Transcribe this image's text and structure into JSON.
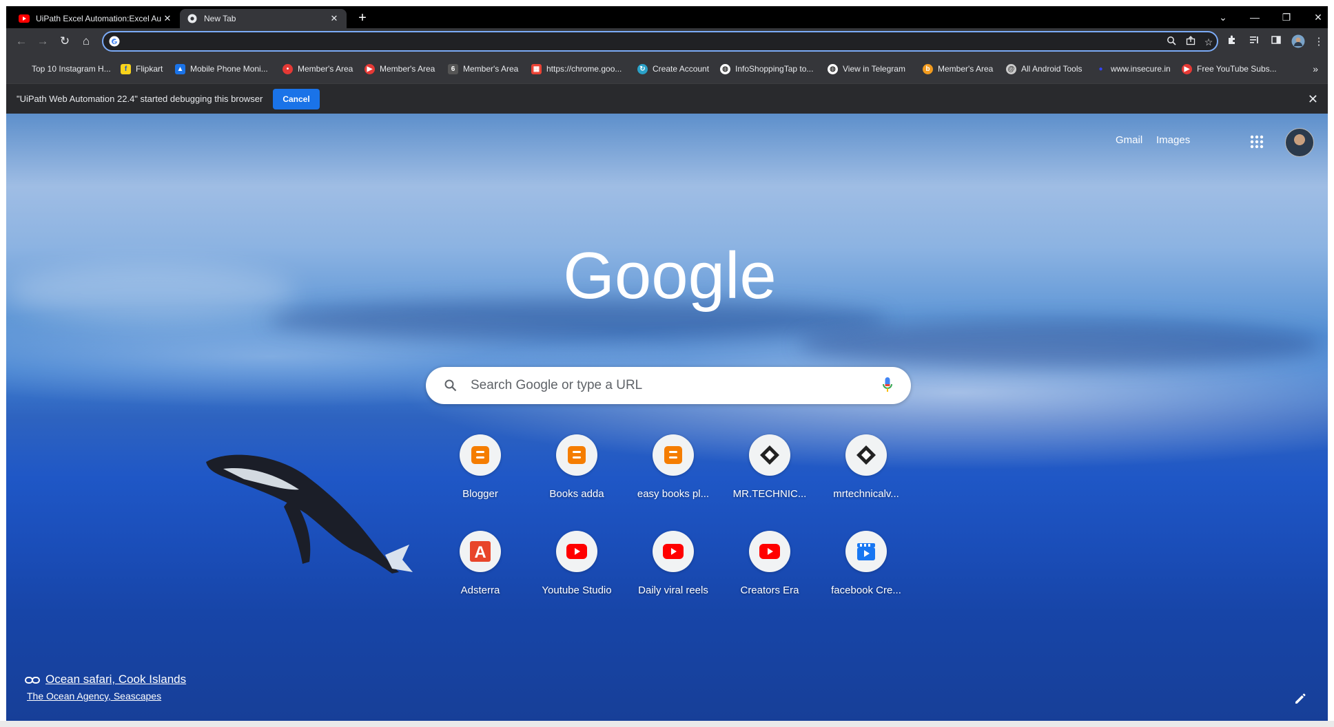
{
  "tabs": [
    {
      "title": "UiPath Excel Automation:Excel Au",
      "favicon": "youtube-icon",
      "active": false
    },
    {
      "title": "New Tab",
      "favicon": "chrome-icon",
      "active": true
    }
  ],
  "window_controls": {
    "minimize": "—",
    "restore": "❐",
    "close": "✕",
    "tab_search": "⌄"
  },
  "toolbar": {
    "omnibox_value": "",
    "back": "←",
    "forward": "→",
    "reload": "↻",
    "home": "⌂"
  },
  "bookmarks": [
    {
      "label": "Top 10 Instagram H...",
      "icon": "blank-icon"
    },
    {
      "label": "Flipkart",
      "icon": "flipkart-icon",
      "color": "#f8d31b"
    },
    {
      "label": "Mobile Phone Moni...",
      "icon": "triangle-a-icon",
      "color": "#1a73e8"
    },
    {
      "label": "Member's Area",
      "icon": "red-circle-icon",
      "color": "#e53935"
    },
    {
      "label": "Member's Area",
      "icon": "red-play-circle-icon",
      "color": "#e53935"
    },
    {
      "label": "Member's Area",
      "icon": "six-icon",
      "color": "#555"
    },
    {
      "label": "https://chrome.goo...",
      "icon": "store-icon",
      "color": "#ea4335"
    },
    {
      "label": "Create Account",
      "icon": "refresh-circle-icon",
      "color": "#2aa1c8"
    },
    {
      "label": "InfoShoppingTap to...",
      "icon": "globe-icon",
      "color": "#fff"
    },
    {
      "label": "View in Telegram",
      "icon": "globe-icon",
      "color": "#fff"
    },
    {
      "label": "Member's Area",
      "icon": "b-icon",
      "color": "#f29b1e"
    },
    {
      "label": "All Android Tools",
      "icon": "at-icon",
      "color": "#ccc"
    },
    {
      "label": "www.insecure.in",
      "icon": "blue-dot-icon",
      "color": "#3344ff"
    },
    {
      "label": "Free YouTube Subs...",
      "icon": "red-play-circle-icon",
      "color": "#e53935"
    }
  ],
  "infobar": {
    "message": "\"UiPath Web Automation 22.4\" started debugging this browser",
    "cancel_label": "Cancel"
  },
  "header": {
    "gmail": "Gmail",
    "images": "Images"
  },
  "logo": {
    "text": "Google"
  },
  "search": {
    "placeholder": "Search Google or type a URL"
  },
  "shortcuts": [
    {
      "label": "Blogger",
      "icon": "blogger-icon",
      "color": "#f57d00"
    },
    {
      "label": "Books adda",
      "icon": "blogger-icon",
      "color": "#f57d00"
    },
    {
      "label": "easy books pl...",
      "icon": "blogger-icon",
      "color": "#f57d00"
    },
    {
      "label": "MR.TECHNIC...",
      "icon": "diamond-icon",
      "color": "#222"
    },
    {
      "label": "mrtechnicalv...",
      "icon": "diamond-icon",
      "color": "#222"
    },
    {
      "label": "Adsterra",
      "icon": "adsterra-icon",
      "color": "#e8452a"
    },
    {
      "label": "Youtube Studio",
      "icon": "youtube-icon",
      "color": "#ff0000"
    },
    {
      "label": "Daily viral reels",
      "icon": "youtube-icon",
      "color": "#ff0000"
    },
    {
      "label": "Creators Era",
      "icon": "youtube-icon",
      "color": "#ff0000"
    },
    {
      "label": "facebook Cre...",
      "icon": "clapper-icon",
      "color": "#1877f2"
    }
  ],
  "attribution": {
    "title": "Ocean safari, Cook Islands",
    "subtitle": "The Ocean Agency, Seascapes"
  },
  "colors": {
    "chrome_dark": "#35363a",
    "accent_blue": "#1a73e8",
    "omnibox_focus": "#7cacf8"
  }
}
